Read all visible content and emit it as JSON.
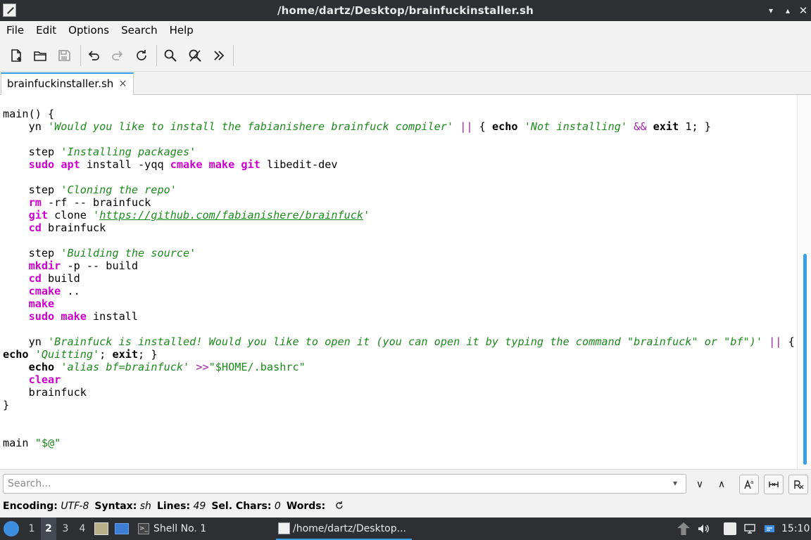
{
  "window": {
    "title": "/home/dartz/Desktop/brainfuckinstaller.sh"
  },
  "menu": [
    "File",
    "Edit",
    "Options",
    "Search",
    "Help"
  ],
  "tab": {
    "label": "brainfuckinstaller.sh",
    "close": "×"
  },
  "code_lines": [
    "main() {",
    "    yn 'Would you like to install the fabianishere brainfuck compiler' || { echo 'Not installing' && exit 1; }",
    "",
    "    step 'Installing packages'",
    "    sudo apt install -yqq cmake make git libedit-dev",
    "",
    "    step 'Cloning the repo'",
    "    rm -rf -- brainfuck",
    "    git clone 'https://github.com/fabianishere/brainfuck'",
    "    cd brainfuck",
    "",
    "    step 'Building the source'",
    "    mkdir -p -- build",
    "    cd build",
    "    cmake ..",
    "    make",
    "    sudo make install",
    "",
    "    yn 'Brainfuck is installed! Would you like to open it (you can open it by typing the command \"brainfuck\" or \"bf\")' || {",
    "echo 'Quitting'; exit; }",
    "    echo 'alias bf=brainfuck' >>\"$HOME/.bashrc\"",
    "    clear",
    "    brainfuck",
    "}",
    "",
    "",
    "main \"$@\""
  ],
  "search": {
    "placeholder": "Search..."
  },
  "status": {
    "encoding_label": "Encoding:",
    "encoding": "UTF-8",
    "syntax_label": "Syntax:",
    "syntax": "sh",
    "lines_label": "Lines:",
    "lines": "49",
    "selchars_label": "Sel. Chars:",
    "selchars": "0",
    "words_label": "Words:"
  },
  "taskbar": {
    "workspaces": [
      "1",
      "2",
      "3",
      "4"
    ],
    "active_workspace": "2",
    "tasks": [
      {
        "label": "Shell No. 1"
      },
      {
        "label": "/home/dartz/Desktop..."
      }
    ],
    "clock": "15:10"
  },
  "colors": {
    "accent": "#3d9ee8",
    "command": "#cc00cc",
    "string": "#1d8a1d",
    "operator": "#a020a0"
  }
}
